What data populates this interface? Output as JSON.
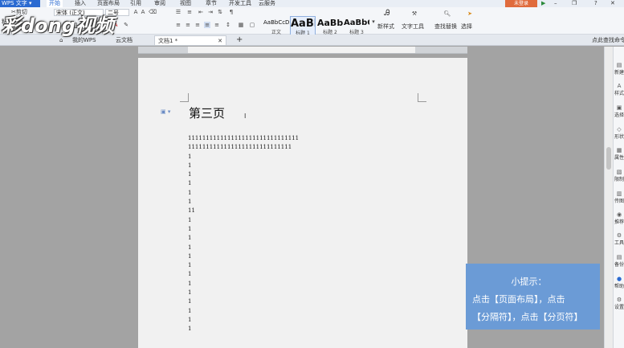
{
  "app": {
    "name": "WPS 文字",
    "login_label": "未登录"
  },
  "menu": [
    "开始",
    "插入",
    "页面布局",
    "引用",
    "审阅",
    "视图",
    "章节",
    "开发工具",
    "云服务"
  ],
  "ribbon": {
    "paste_label": "粘贴",
    "cut_label": "剪切",
    "copy_label": "复制",
    "format_painter_label": "格式刷",
    "font_name": "宋体 (正文)",
    "font_size": "二号",
    "styles": [
      {
        "preview": "AaBbCcDd",
        "label": "正文"
      },
      {
        "preview": "AaBl",
        "label": "标题 1"
      },
      {
        "preview": "AaBb(",
        "label": "标题 2"
      },
      {
        "preview": "AaBbC",
        "label": "标题 3"
      }
    ],
    "new_style_label": "新样式",
    "text_tools_label": "文字工具",
    "find_replace_label": "查找替换",
    "select_label": "选择"
  },
  "tabs": {
    "my_wps": "我的WPS",
    "cloud_doc": "云文档",
    "doc1": "文档1 *",
    "search_placeholder": "点此查找命令"
  },
  "document": {
    "heading": "第三页",
    "lines": [
      "1111111111111111111111111111111",
      "11111111111111111111111111111",
      "1",
      "1",
      "1",
      "1",
      "1",
      "1",
      "11",
      "1",
      "1",
      "1",
      "1",
      "1",
      "1",
      "1",
      "1",
      "1",
      "1",
      "1",
      "1",
      "1"
    ]
  },
  "right_panel": [
    "新建",
    "样式",
    "选择",
    "形状",
    "属性",
    "限制",
    "传图",
    "推荐",
    "工具",
    "备份",
    "帮助",
    "设置"
  ],
  "hint": {
    "title": "小提示：",
    "line1": "点击【页面布局】，点击",
    "line2": "【分隔符】，点击【分页符】"
  },
  "watermark": "彩dong视频"
}
